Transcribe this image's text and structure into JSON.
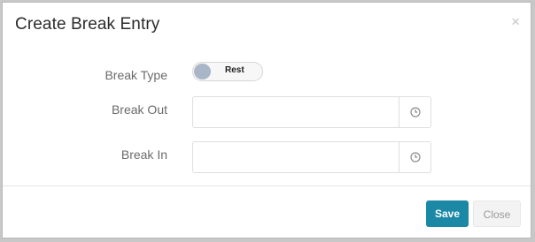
{
  "modal": {
    "title": "Create Break Entry",
    "close_symbol": "×"
  },
  "form": {
    "break_type": {
      "label": "Break Type",
      "toggle_value": "Rest",
      "toggle_on": false
    },
    "break_out": {
      "label": "Break Out",
      "value": "",
      "icon": "clock-icon"
    },
    "break_in": {
      "label": "Break In",
      "value": "",
      "icon": "clock-icon"
    }
  },
  "footer": {
    "save_label": "Save",
    "close_label": "Close"
  },
  "colors": {
    "primary": "#1b88a6",
    "toggle_knob": "#a9b6c8"
  }
}
